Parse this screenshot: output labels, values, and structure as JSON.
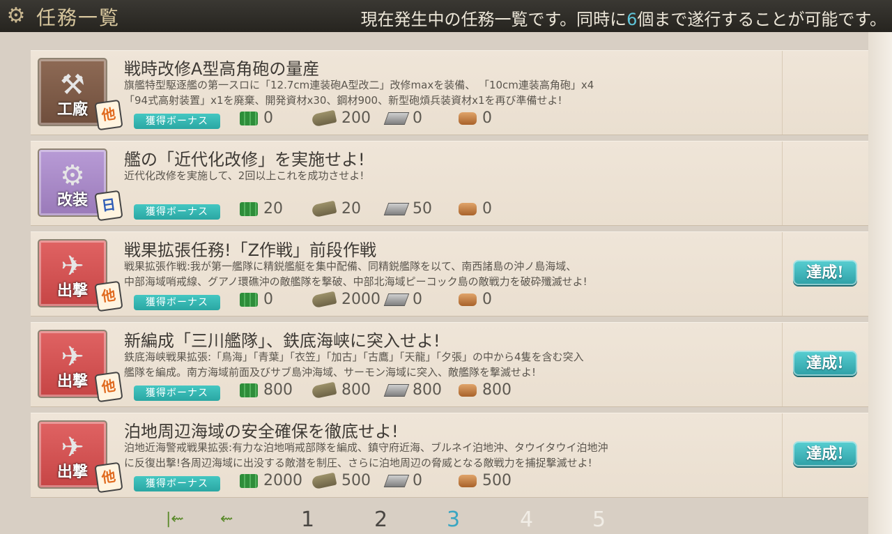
{
  "header": {
    "title": "任務一覧",
    "info_prefix": "現在発生中の任務一覧です。同時に",
    "info_number": "6",
    "info_suffix": "個まで遂行することが可能です。"
  },
  "bonus_label": "獲得ボーナス",
  "complete_label": "達成!",
  "quests": [
    {
      "category": "工廠",
      "badge": "他",
      "title": "戦時改修A型高角砲の量産",
      "desc": [
        "旗艦特型駆逐艦の第一スロに「12.7cm連装砲A型改二」改修maxを装備、 「10cm連装高角砲」x4",
        "「94式高射装置」x1を廃棄、開発資材x30、鋼材900、新型砲熕兵装資材x1を再び準備せよ!"
      ],
      "fuel": "0",
      "ammo": "200",
      "steel": "0",
      "bauxite": "0",
      "completed": false
    },
    {
      "category": "改装",
      "badge": "日",
      "title": "艦の「近代化改修」を実施せよ!",
      "desc": [
        "近代化改修を実施して、2回以上これを成功させよ!"
      ],
      "fuel": "20",
      "ammo": "20",
      "steel": "50",
      "bauxite": "0",
      "completed": false
    },
    {
      "category": "出撃",
      "badge": "他",
      "title": "戦果拡張任務!「Z作戦」前段作戦",
      "desc": [
        "戦果拡張作戦:我が第一艦隊に精鋭艦艇を集中配備、同精鋭艦隊を以て、南西諸島の沖ノ島海域、",
        "中部海域哨戒線、グアノ環礁沖の敵艦隊を撃破、中部北海域ピーコック島の敵戦力を破砕殲滅せよ!"
      ],
      "fuel": "0",
      "ammo": "2000",
      "steel": "0",
      "bauxite": "0",
      "completed": true
    },
    {
      "category": "出撃",
      "badge": "他",
      "title": "新編成「三川艦隊」、鉄底海峡に突入せよ!",
      "desc": [
        "鉄底海峡戦果拡張:「鳥海」「青葉」「衣笠」「加古」「古鷹」「天龍」「夕張」の中から4隻を含む突入",
        "艦隊を編成。南方海域前面及びサブ島沖海域、サーモン海域に突入、敵艦隊を撃滅せよ!"
      ],
      "fuel": "800",
      "ammo": "800",
      "steel": "800",
      "bauxite": "800",
      "completed": true
    },
    {
      "category": "出撃",
      "badge": "他",
      "title": "泊地周辺海域の安全確保を徹底せよ!",
      "desc": [
        "泊地近海警戒戦果拡張:有力な泊地哨戒部隊を編成、鎮守府近海、ブルネイ泊地沖、タウイタウイ泊地沖",
        "に反復出撃!各周辺海域に出没する敵潜を制圧、さらに泊地周辺の脅威となる敵戦力を捕捉撃滅せよ!"
      ],
      "fuel": "2000",
      "ammo": "500",
      "steel": "0",
      "bauxite": "500",
      "completed": true
    }
  ],
  "pager": {
    "first_arrow": "|⇜",
    "prev_arrow": "⇜",
    "pages": [
      "1",
      "2",
      "3",
      "4",
      "5"
    ],
    "current": "3"
  },
  "colors": {
    "accent": "#3aa6c2",
    "bonus": "#2aa7a3",
    "header_bg": "#26241f"
  }
}
